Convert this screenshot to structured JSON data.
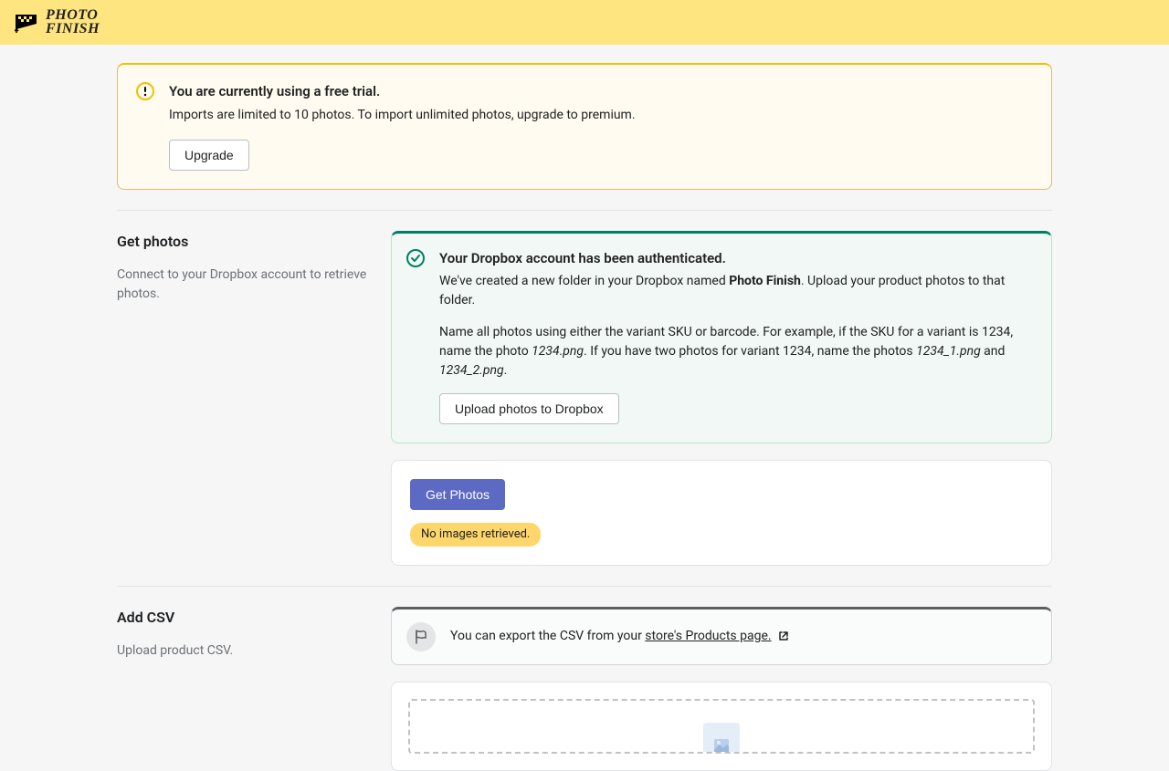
{
  "logo": {
    "line1": "PHOTO",
    "line2": "FINISH"
  },
  "banner": {
    "title": "You are currently using a free trial.",
    "desc": "Imports are limited to 10 photos. To import unlimited photos, upgrade to premium.",
    "button": "Upgrade"
  },
  "getphotos": {
    "title": "Get photos",
    "desc": "Connect to your Dropbox account to retrieve photos.",
    "success_title": "Your Dropbox account has been authenticated.",
    "success_p1_a": "We've created a new folder in your Dropbox named ",
    "success_p1_bold": "Photo Finish",
    "success_p1_b": ". Upload your product photos to that folder.",
    "success_p2_a": "Name all photos using either the variant SKU or barcode. For example, if the SKU for a variant is 1234, name the photo ",
    "success_p2_em1": "1234.png",
    "success_p2_b": ". If you have two photos for variant 1234, name the photos ",
    "success_p2_em2": "1234_1.png",
    "success_p2_c": " and ",
    "success_p2_em3": "1234_2.png",
    "success_p2_d": ".",
    "upload_button": "Upload photos to Dropbox",
    "get_button": "Get Photos",
    "badge": "No images retrieved."
  },
  "addcsv": {
    "title": "Add CSV",
    "desc": "Upload product CSV.",
    "info_a": "You can export the CSV from your ",
    "info_link": "store's Products page."
  }
}
